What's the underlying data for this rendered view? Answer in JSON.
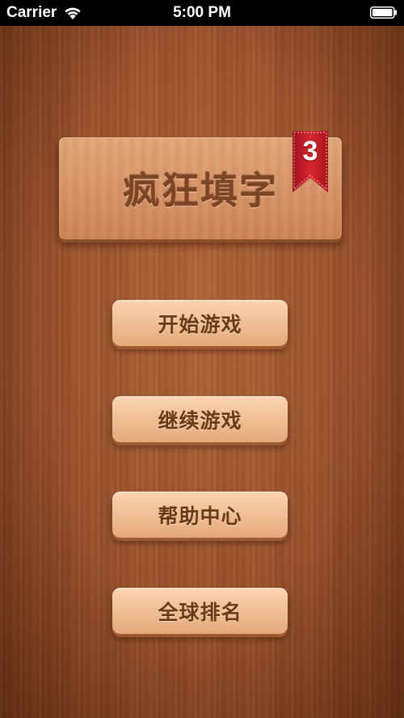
{
  "status_bar": {
    "carrier": "Carrier",
    "time": "5:00 PM"
  },
  "title": {
    "text": "疯狂填字",
    "badge_number": "3",
    "badge_color": "#c8202a"
  },
  "menu": {
    "items": [
      {
        "label": "开始游戏"
      },
      {
        "label": "继续游戏"
      },
      {
        "label": "帮助中心"
      },
      {
        "label": "全球排名"
      }
    ]
  },
  "colors": {
    "wood": "#9b5530",
    "button_face": "#f0bf95",
    "button_text": "#6a3a17",
    "title_text": "#7c4524"
  }
}
